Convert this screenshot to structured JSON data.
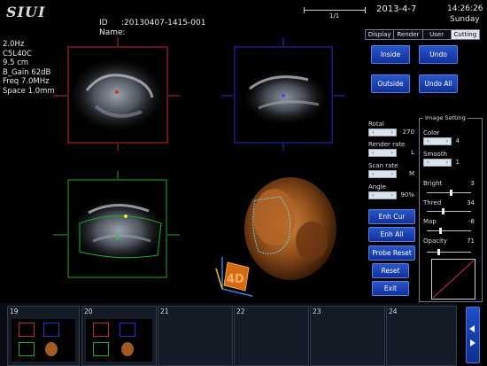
{
  "brand": "SIUI",
  "patient": {
    "id_label": "ID",
    "id_value": ":20130407-1415-001",
    "name_label": "Name:"
  },
  "header": {
    "progress_label": "1/1",
    "date": "2013-4-7",
    "time": "14:26:26",
    "weekday": "Sunday"
  },
  "params": [
    "2.0Hz",
    "C5L40C",
    "9.5 cm",
    "B_Gain 62dB",
    "Freq 7.0MHz",
    "Space 1.0mm"
  ],
  "tabs": [
    {
      "label": "Display",
      "active": false
    },
    {
      "label": "Render",
      "active": false
    },
    {
      "label": "User",
      "active": false
    },
    {
      "label": "Cutting",
      "active": true
    }
  ],
  "buttons": {
    "inside": "Inside",
    "undo": "Undo",
    "outside": "Outside",
    "undo_all": "Undo All",
    "enh_cur": "Enh Cur",
    "enh_all": "Enh All",
    "probe_reset": "Probe Reset",
    "reset": "Reset",
    "exit": "Exit"
  },
  "left_controls": {
    "rotal": {
      "label": "Rotal",
      "value": "270"
    },
    "render_rate": {
      "label": "Render rate",
      "value": "L"
    },
    "scan_rate": {
      "label": "Scan rate",
      "value": "M"
    },
    "angle": {
      "label": "Angle",
      "value": "90%"
    }
  },
  "image_setting": {
    "title": "Image Setting",
    "color": {
      "label": "Color",
      "value": "4"
    },
    "smooth": {
      "label": "Smooth",
      "value": "1"
    },
    "bright": {
      "label": "Bright",
      "value": "3"
    },
    "thred": {
      "label": "Thred",
      "value": "34"
    },
    "map": {
      "label": "Map",
      "value": "-8"
    },
    "opacity": {
      "label": "Opacity",
      "value": "71"
    }
  },
  "thumbnails": [
    "19",
    "20",
    "21",
    "22",
    "23",
    "24"
  ],
  "stepper_arrows": {
    "left": "‹",
    "right": "›"
  },
  "orient_label": "4D",
  "colors": {
    "red": "#c0282a",
    "blue": "#2430c8",
    "green": "#22a830",
    "button": "#1f44b8"
  }
}
